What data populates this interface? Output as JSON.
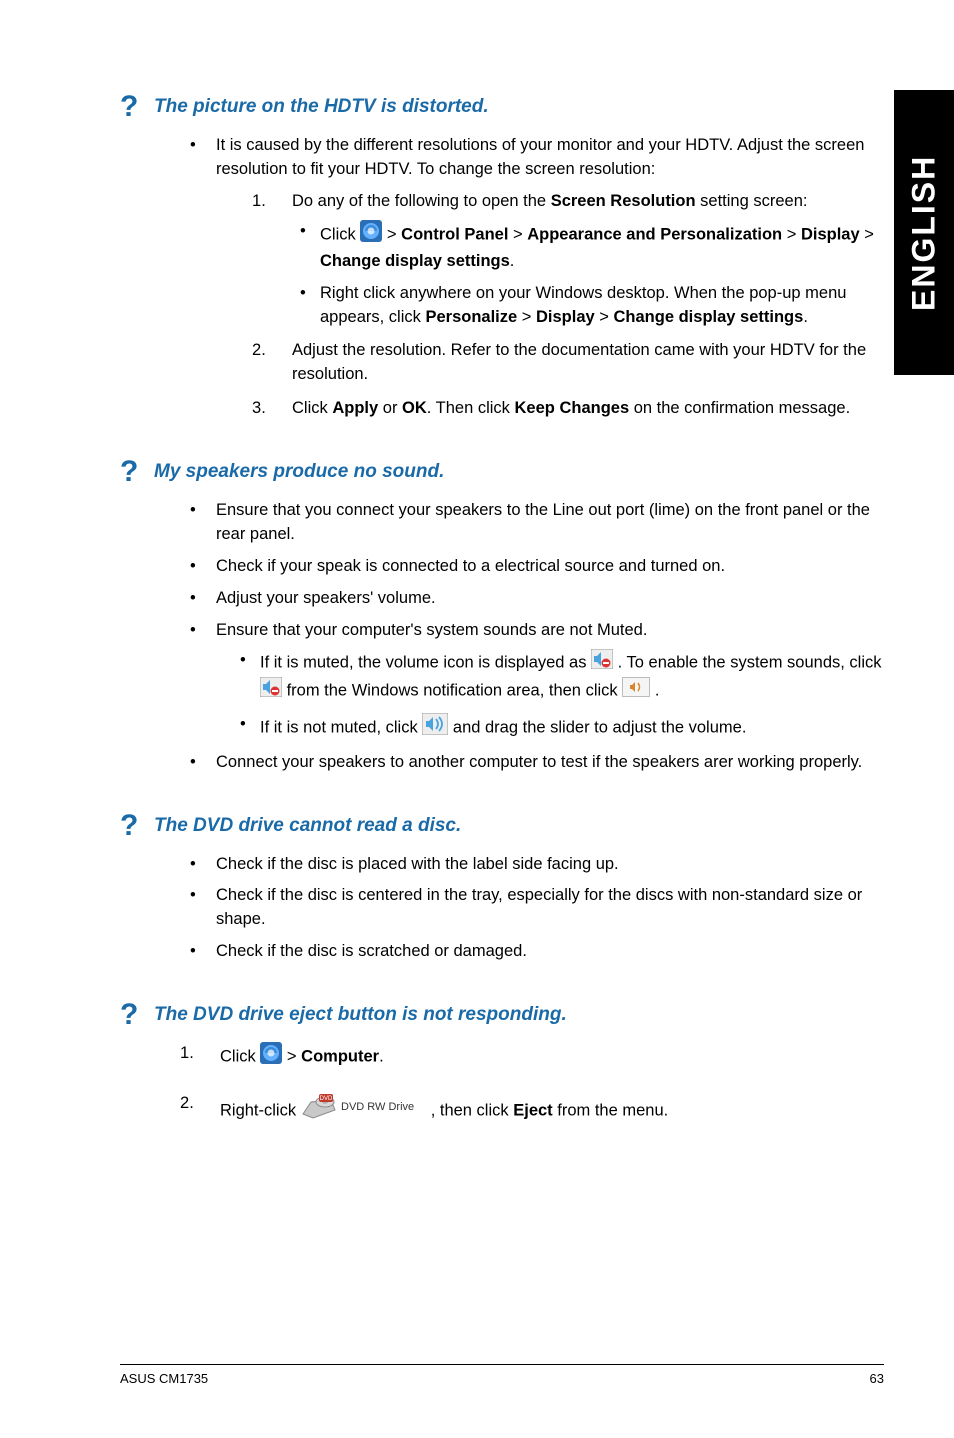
{
  "lang_tab": "ENGLISH",
  "sections": {
    "s1": {
      "heading": "The picture on the HDTV is distorted.",
      "intro": "It is caused by the different resolutions of your monitor and your HDTV. Adjust the screen resolution to fit your HDTV. To change the screen resolution:",
      "step1_pre": "Do any of the following to open the ",
      "step1_bold": "Screen Resolution",
      "step1_post": " setting screen:",
      "sb1_click": "Click ",
      "sb1_gt1": " > ",
      "sb1_b1": "Control Panel",
      "sb1_gt2": " > ",
      "sb1_b2": "Appearance and Personalization",
      "sb1_gt3": " > ",
      "sb1_b3": "Display",
      "sb1_gt4": " > ",
      "sb1_b4": "Change display settings",
      "sb1_dot": ".",
      "sb2_pre": "Right click anywhere on your Windows desktop. When the pop-up menu appears, click ",
      "sb2_b1": "Personalize",
      "sb2_gt1": " > ",
      "sb2_b2": "Display",
      "sb2_gt2": " > ",
      "sb2_b3": "Change display settings",
      "sb2_dot": ".",
      "step2": "Adjust the resolution. Refer to the documentation came with your HDTV for the resolution.",
      "step3_pre": "Click ",
      "step3_b1": "Apply",
      "step3_or": " or ",
      "step3_b2": "OK",
      "step3_mid": ". Then click ",
      "step3_b3": "Keep Changes",
      "step3_post": " on the confirmation message."
    },
    "s2": {
      "heading": "My speakers produce no sound.",
      "b1": "Ensure that you connect your speakers to the Line out port (lime) on the front panel or the rear panel.",
      "b2": "Check if your speak is connected to a electrical source and turned on.",
      "b3": "Adjust your speakers' volume.",
      "b4": "Ensure that your computer's system sounds are not Muted.",
      "b4s1_pre": "If it is muted, the volume icon is displayed as ",
      "b4s1_mid": " . To enable the system sounds, click ",
      "b4s1_mid2": " from the Windows notification area, then click ",
      "b4s1_post": " .",
      "b4s2_pre": "If it is not muted, click ",
      "b4s2_post": " and drag the slider to adjust the volume.",
      "b5": "Connect your speakers to another computer to test if the speakers arer working properly."
    },
    "s3": {
      "heading": "The DVD drive cannot read a disc.",
      "b1": "Check if the disc is placed with the label side facing up.",
      "b2": "Check if the disc is centered in the tray, especially for the discs with non-standard size or shape.",
      "b3": "Check if the disc is scratched or damaged."
    },
    "s4": {
      "heading": "The DVD drive eject button is not responding.",
      "step1_pre": "Click ",
      "step1_gt": " > ",
      "step1_b": "Computer",
      "step1_dot": ".",
      "step2_pre": "Right-click ",
      "step2_mid": ", then click ",
      "step2_b": "Eject",
      "step2_post": " from the menu."
    }
  },
  "footer": {
    "left": "ASUS CM1735",
    "right": "63"
  },
  "icons": {
    "start": "start-orb-icon",
    "speaker_muted": "speaker-muted-icon",
    "mixer": "volume-mixer-icon",
    "speaker": "speaker-icon",
    "dvd_drive": "dvd-rw-drive-icon"
  }
}
